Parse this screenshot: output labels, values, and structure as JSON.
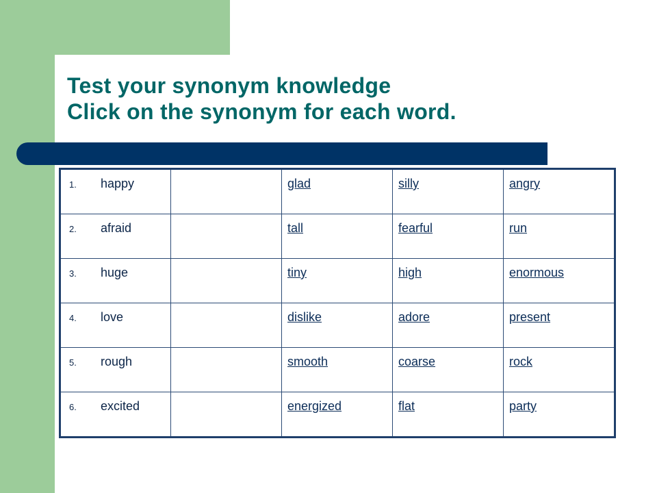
{
  "title": {
    "line1": "Test your synonym knowledge",
    "line2": "Click on the synonym for each word."
  },
  "colors": {
    "accent_green": "#9ccc9a",
    "title_teal": "#006666",
    "bar_navy": "#003366",
    "link_navy": "#0b2c57"
  },
  "quiz": {
    "rows": [
      {
        "number": "1.",
        "word": "happy",
        "options": [
          "glad",
          "silly",
          "angry"
        ]
      },
      {
        "number": "2.",
        "word": "afraid",
        "options": [
          "tall",
          "fearful",
          "run"
        ]
      },
      {
        "number": "3.",
        "word": "huge",
        "options": [
          "tiny",
          "high",
          "enormous"
        ]
      },
      {
        "number": "4.",
        "word": "love",
        "options": [
          "dislike",
          "adore",
          "present"
        ]
      },
      {
        "number": "5.",
        "word": "rough",
        "options": [
          "smooth",
          "coarse",
          "rock"
        ]
      },
      {
        "number": "6.",
        "word": "excited",
        "options": [
          "energized",
          "flat",
          "party"
        ]
      }
    ]
  }
}
